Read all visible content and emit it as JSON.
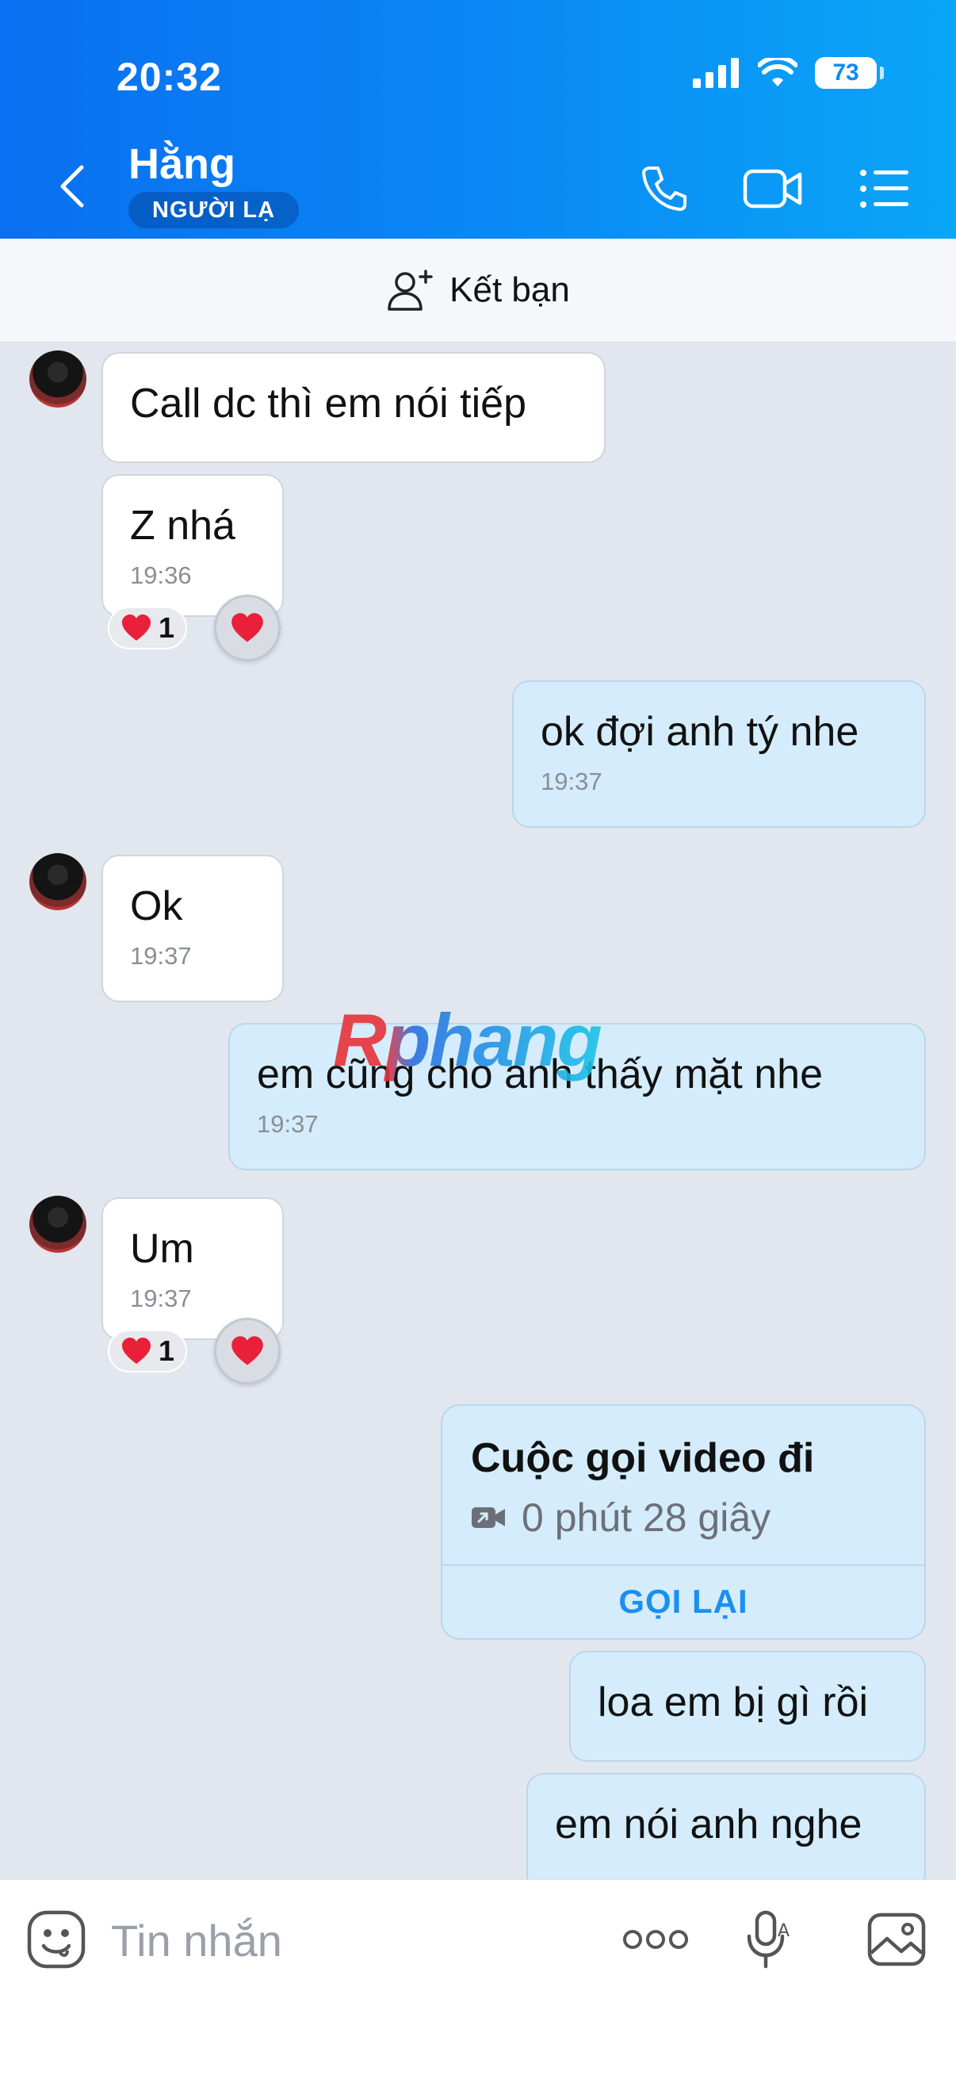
{
  "status_bar": {
    "time": "20:32",
    "battery": "73"
  },
  "header": {
    "contact_name": "Hằng",
    "badge": "NGƯỜI LẠ"
  },
  "friend_bar": {
    "label": "Kết bạn"
  },
  "messages": [
    {
      "dir": "in",
      "text": "Call dc thì em nói tiếp",
      "time": ""
    },
    {
      "dir": "in",
      "text": "Z nhá",
      "time": "19:36",
      "reaction_count": "1"
    },
    {
      "dir": "out",
      "text": "ok đợi anh tý nhe",
      "time": "19:37"
    },
    {
      "dir": "in",
      "text": "Ok",
      "time": "19:37"
    },
    {
      "dir": "out",
      "text": "em cũng cho anh thấy mặt nhe",
      "time": "19:37"
    },
    {
      "dir": "in",
      "text": "Um",
      "time": "19:37",
      "reaction_count": "1"
    },
    {
      "dir": "out",
      "text": "loa em bị gì rồi",
      "time": ""
    },
    {
      "dir": "out",
      "text": "em nói anh nghe",
      "time": ""
    }
  ],
  "call_card": {
    "title": "Cuộc gọi video đi",
    "duration": "0 phút 28 giây",
    "action": "GỌI LẠI"
  },
  "watermark": "Rphang",
  "input": {
    "placeholder": "Tin nhắn"
  },
  "colors": {
    "header_start": "#0a6ff0",
    "header_end": "#0aa6f7",
    "outgoing_bubble": "#d4ecfb",
    "incoming_bubble": "#ffffff",
    "chat_bg": "#e2e7ef",
    "accent": "#1b8fef",
    "heart": "#e8203a"
  }
}
